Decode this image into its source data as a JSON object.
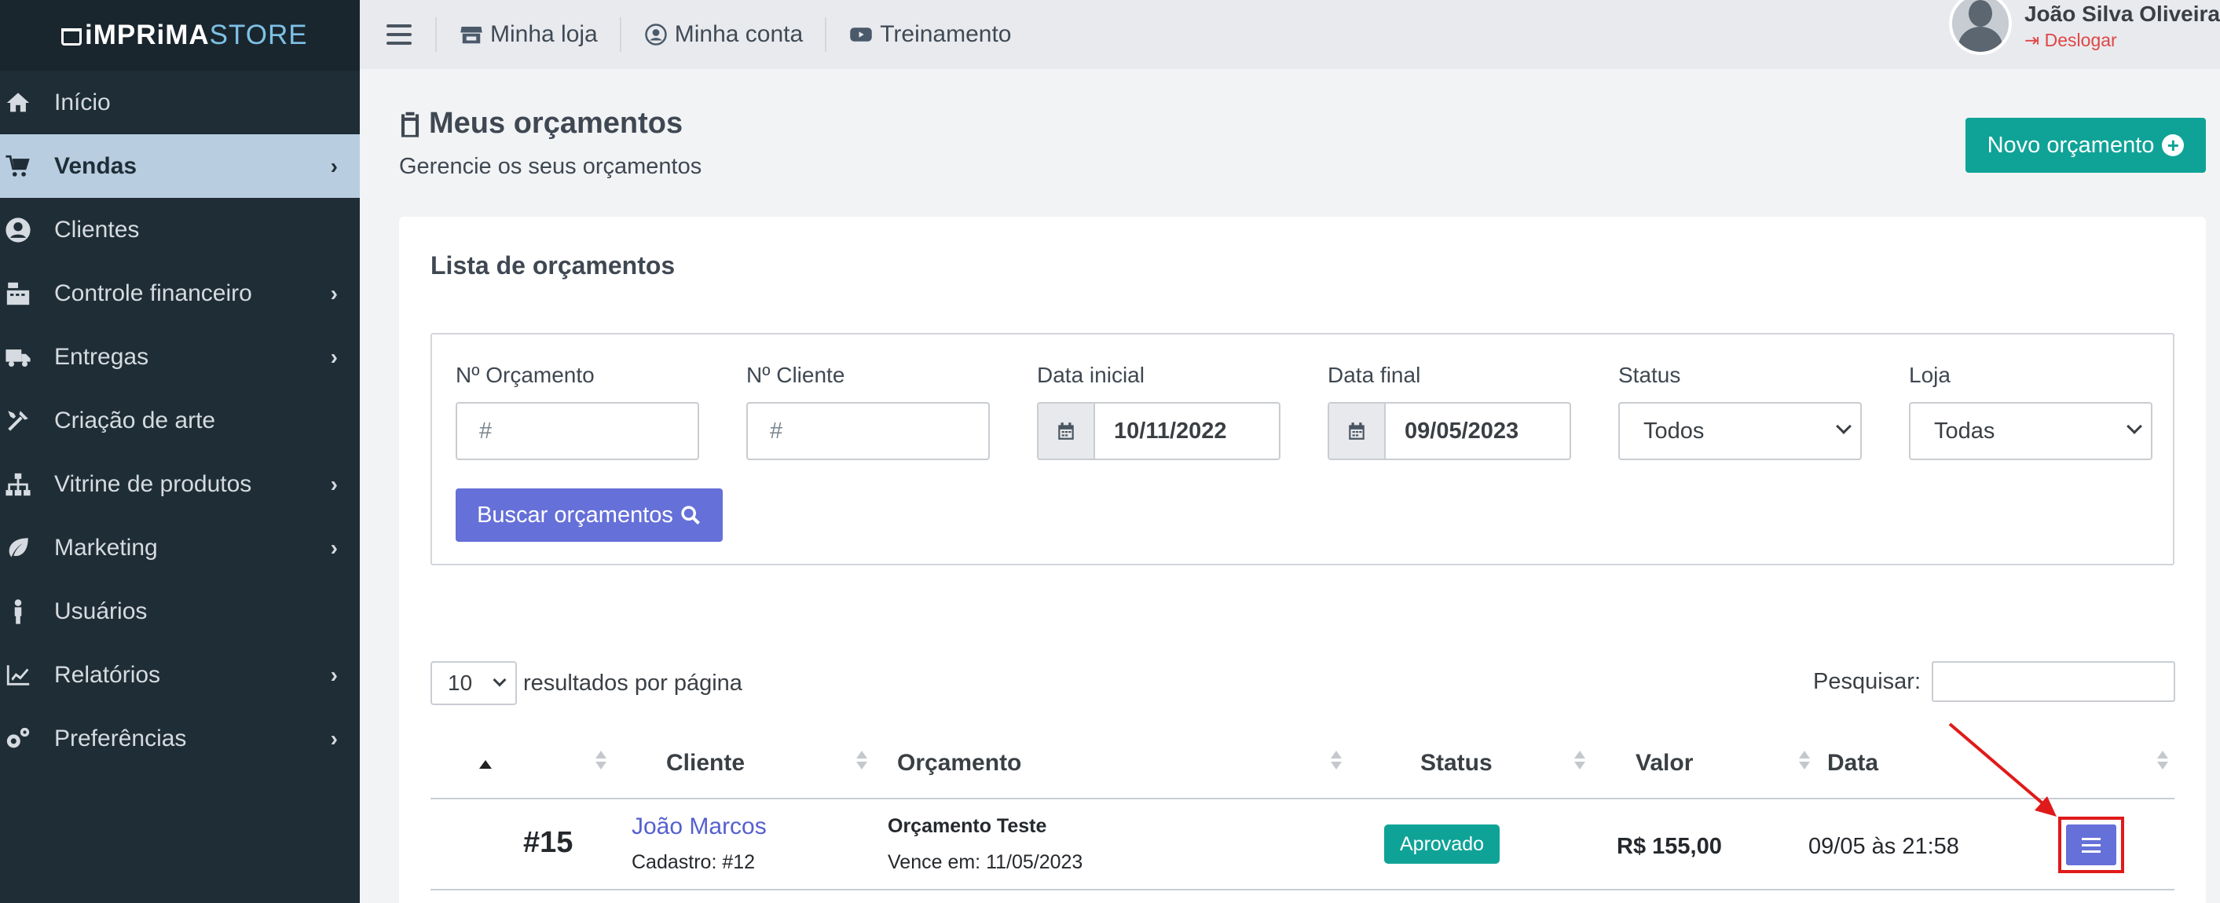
{
  "brand": {
    "name_part1": "iMPRiMA",
    "name_part2": "STORE",
    "icon": "cart-icon"
  },
  "sidebar": {
    "items": [
      {
        "label": "Início",
        "icon": "home-icon",
        "active": false,
        "has_children": false
      },
      {
        "label": "Vendas",
        "icon": "cart-icon",
        "active": true,
        "has_children": true
      },
      {
        "label": "Clientes",
        "icon": "user-circle-icon",
        "active": false,
        "has_children": false
      },
      {
        "label": "Controle financeiro",
        "icon": "cash-register-icon",
        "active": false,
        "has_children": true
      },
      {
        "label": "Entregas",
        "icon": "truck-icon",
        "active": false,
        "has_children": true
      },
      {
        "label": "Criação de arte",
        "icon": "tools-icon",
        "active": false,
        "has_children": false
      },
      {
        "label": "Vitrine de produtos",
        "icon": "sitemap-icon",
        "active": false,
        "has_children": true
      },
      {
        "label": "Marketing",
        "icon": "leaf-icon",
        "active": false,
        "has_children": true
      },
      {
        "label": "Usuários",
        "icon": "person-icon",
        "active": false,
        "has_children": false
      },
      {
        "label": "Relatórios",
        "icon": "chart-line-icon",
        "active": false,
        "has_children": true
      },
      {
        "label": "Preferências",
        "icon": "gears-icon",
        "active": false,
        "has_children": true
      }
    ]
  },
  "topbar": {
    "links": [
      {
        "label": "Minha loja",
        "icon": "store-icon"
      },
      {
        "label": "Minha conta",
        "icon": "user-circle-icon"
      },
      {
        "label": "Treinamento",
        "icon": "youtube-icon"
      }
    ],
    "user": {
      "name": "João Silva Oliveira",
      "logout_label": "Deslogar"
    }
  },
  "page": {
    "title": "Meus orçamentos",
    "subtitle": "Gerencie os seus orçamentos",
    "new_button": "Novo orçamento"
  },
  "card": {
    "title": "Lista de orçamentos",
    "filters": {
      "quote_no": {
        "label": "Nº Orçamento",
        "placeholder": "#"
      },
      "client_no": {
        "label": "Nº Cliente",
        "placeholder": "#"
      },
      "start_date": {
        "label": "Data inicial",
        "value": "10/11/2022"
      },
      "end_date": {
        "label": "Data final",
        "value": "09/05/2023"
      },
      "status": {
        "label": "Status",
        "value": "Todos"
      },
      "store": {
        "label": "Loja",
        "value": "Todas"
      },
      "search_button": "Buscar orçamentos"
    },
    "per_page": {
      "value": "10",
      "label": "resultados por página"
    },
    "search_label": "Pesquisar:",
    "columns": [
      "Cliente",
      "Orçamento",
      "Status",
      "Valor",
      "Data"
    ],
    "rows": [
      {
        "id": "#15",
        "client_name": "João Marcos",
        "client_sub": "Cadastro: #12",
        "quote_name": "Orçamento Teste",
        "quote_due": "Vence em: 11/05/2023",
        "status": "Aprovado",
        "value": "R$ 155,00",
        "date": "09/05 às 21:58"
      }
    ]
  },
  "colors": {
    "sidebar_bg": "#1f2d36",
    "active_item_bg": "#b8cde0",
    "teal": "#0fa397",
    "indigo": "#6570d8",
    "highlight_red": "#e01a1a"
  }
}
